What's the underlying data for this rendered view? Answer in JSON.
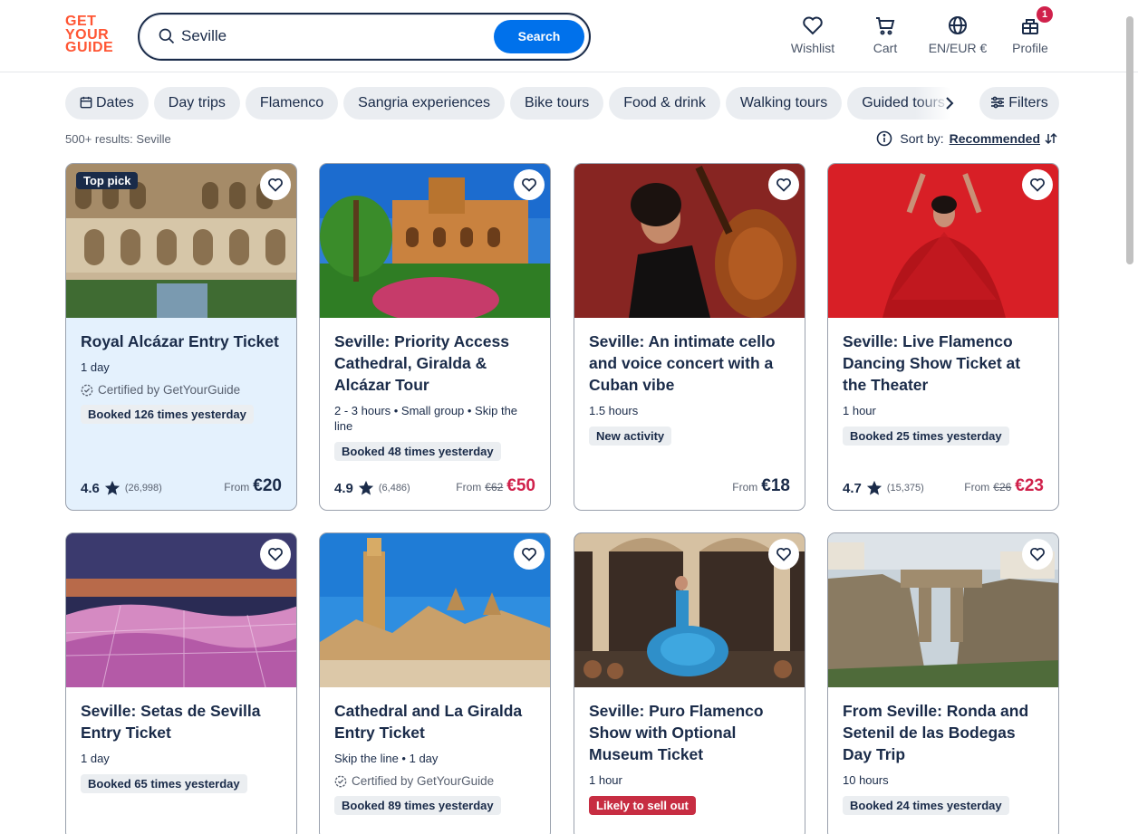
{
  "header": {
    "logo_lines": [
      "GET",
      "YOUR",
      "GUIDE"
    ],
    "search_query": "Seville",
    "search_button": "Search",
    "nav": [
      {
        "label": "Wishlist",
        "icon": "heart-icon"
      },
      {
        "label": "Cart",
        "icon": "cart-icon"
      },
      {
        "label": "EN/EUR €",
        "icon": "globe-icon"
      },
      {
        "label": "Profile",
        "icon": "profile-icon",
        "badge": "1"
      }
    ]
  },
  "chips": [
    "Dates",
    "Day trips",
    "Flamenco",
    "Sangria experiences",
    "Bike tours",
    "Food & drink",
    "Walking tours",
    "Guided tours"
  ],
  "filters_label": "Filters",
  "results_text": "500+ results: Seville",
  "sort": {
    "label": "Sort by:",
    "value": "Recommended"
  },
  "cards": [
    {
      "tag": "Top pick",
      "title": "Royal Alcázar Entry Ticket",
      "meta": "1 day",
      "certified": "Certified by GetYourGuide",
      "booked": "Booked 126 times yesterday",
      "rating": "4.6",
      "reviews": "(26,998)",
      "from": "From",
      "old_price": "",
      "price": "€20"
    },
    {
      "title": "Seville: Priority Access Cathedral, Giralda & Alcázar Tour",
      "meta": "2 - 3 hours • Small group • Skip the line",
      "booked": "Booked 48 times yesterday",
      "rating": "4.9",
      "reviews": "(6,486)",
      "from": "From",
      "old_price": "€62",
      "price": "€50"
    },
    {
      "title": "Seville: An intimate cello and voice concert with a Cuban vibe",
      "meta": "1.5 hours",
      "booked": "New activity",
      "rating": "",
      "reviews": "",
      "from": "From",
      "old_price": "",
      "price": "€18"
    },
    {
      "title": "Seville: Live Flamenco Dancing Show Ticket at the Theater",
      "meta": "1 hour",
      "booked": "Booked 25 times yesterday",
      "rating": "4.7",
      "reviews": "(15,375)",
      "from": "From",
      "old_price": "€26",
      "price": "€23"
    },
    {
      "title": "Seville: Setas de Sevilla Entry Ticket",
      "meta": "1 day",
      "booked": "Booked 65 times yesterday"
    },
    {
      "title": "Cathedral and La Giralda Entry Ticket",
      "meta": "Skip the line • 1 day",
      "certified": "Certified by GetYourGuide",
      "booked": "Booked 89 times yesterday"
    },
    {
      "title": "Seville: Puro Flamenco Show with Optional Museum Ticket",
      "meta": "1 hour",
      "booked": "Likely to sell out"
    },
    {
      "title": "From Seville: Ronda and Setenil de las Bodegas Day Trip",
      "meta": "10 hours",
      "booked": "Booked 24 times yesterday"
    }
  ],
  "colors": {
    "brand": "#ff5533",
    "primary": "#0071eb",
    "sale": "#d0214b",
    "highlight": "#e4f1fd"
  }
}
